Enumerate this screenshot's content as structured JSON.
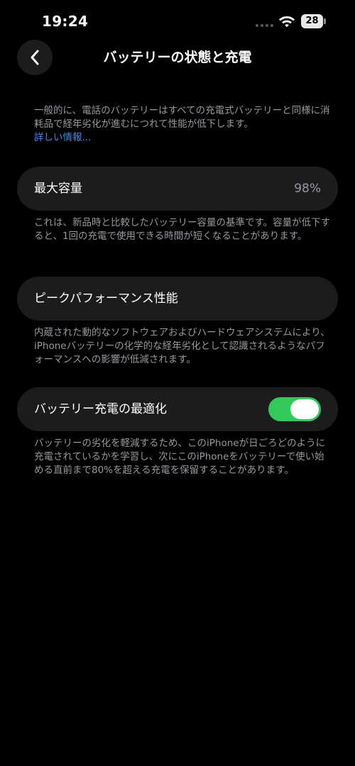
{
  "status_bar": {
    "time": "19:24",
    "battery_level": "28",
    "wifi_icon": "wifi-icon",
    "signal_icon": "cellular-signal-icon",
    "battery_icon": "battery-icon"
  },
  "nav": {
    "back_icon": "chevron-left-icon",
    "title": "バッテリーの状態と充電"
  },
  "intro": {
    "text": "一般的に、電話のバッテリーはすべての充電式バッテリーと同様に消耗品で経年劣化が進むにつれて性能が低下します。",
    "link": "詳しい情報..."
  },
  "max_capacity": {
    "label": "最大容量",
    "value": "98%",
    "description": "これは、新品時と比較したバッテリー容量の基準です。容量が低下すると、1回の充電で使用できる時間が短くなることがあります。"
  },
  "peak_performance": {
    "label": "ピークパフォーマンス性能",
    "description": "内蔵された動的なソフトウェアおよびハードウェアシステムにより、iPhoneバッテリーの化学的な経年劣化として認識されるようなパフォーマンスへの影響が低減されます。"
  },
  "optimized_charging": {
    "label": "バッテリー充電の最適化",
    "enabled": true,
    "description": "バッテリーの劣化を軽減するため、このiPhoneが日ごろどのように充電されているかを学習し、次にこのiPhoneをバッテリーで使い始める直前まで80%を超える充電を保留することがあります。"
  },
  "colors": {
    "background": "#000000",
    "card": "#1c1c1e",
    "secondary_text": "#98989f",
    "link": "#3a8bf5",
    "toggle_on": "#34c759"
  }
}
